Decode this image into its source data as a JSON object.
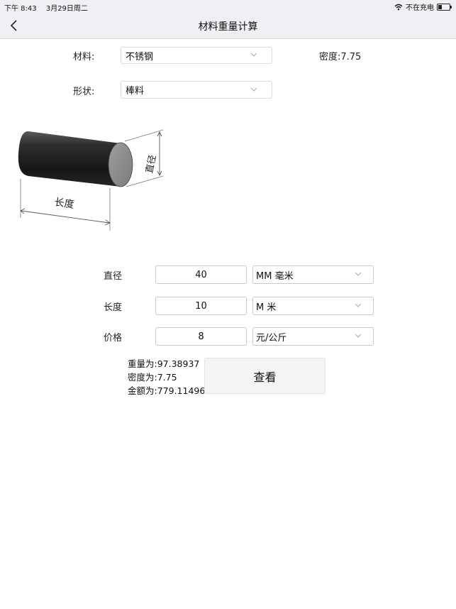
{
  "status": {
    "time": "下午 8:43",
    "date": "3月29日周二",
    "charging": "不在充电",
    "battery_level": 0.35
  },
  "nav": {
    "title": "材料重量计算"
  },
  "material": {
    "label": "材料:",
    "value": "不锈钢",
    "density": "密度:7.75"
  },
  "shape": {
    "label": "形状:",
    "value": "棒料"
  },
  "diagram": {
    "diameter_label": "直径",
    "length_label": "长度"
  },
  "inputs": {
    "diameter": {
      "label": "直径",
      "value": "40",
      "unit": "MM 毫米"
    },
    "length": {
      "label": "长度",
      "value": "10",
      "unit": "M 米"
    },
    "price": {
      "label": "价格",
      "value": "8",
      "unit": "元/公斤"
    }
  },
  "result": {
    "weight": "重量为:97.38937",
    "density": "密度为:7.75",
    "amount": "金额为:779.11496"
  },
  "view_button": "查看",
  "colors": {
    "bar_bg": "#efeff4",
    "rod_dark": "#1e1e1e",
    "rod_face": "#8f8f8f"
  }
}
